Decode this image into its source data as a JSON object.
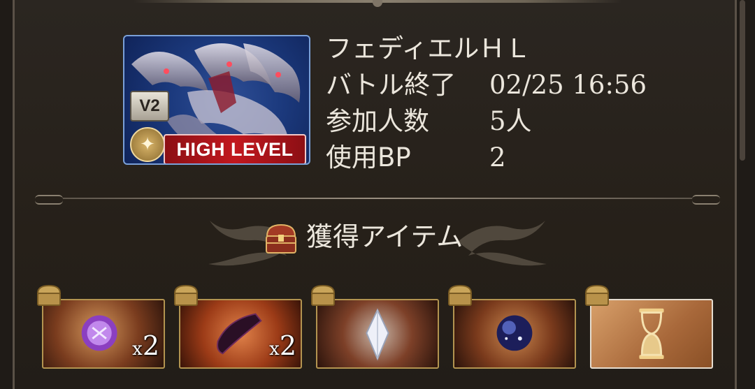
{
  "quest": {
    "name": "フェディエルＨＬ",
    "version_badge": "V2",
    "level_label": "HIGH LEVEL",
    "rows": [
      {
        "label": "バトル終了",
        "value": "02/25 16:56"
      },
      {
        "label": "参加人数",
        "value": "5人"
      },
      {
        "label": "使用BP",
        "value": "2"
      }
    ]
  },
  "loot": {
    "title": "獲得アイテム",
    "items": [
      {
        "icon": "purple-orb-icon",
        "qty_prefix": "x",
        "qty": "2"
      },
      {
        "icon": "dark-fang-icon",
        "qty_prefix": "x",
        "qty": "2"
      },
      {
        "icon": "silver-crystal-icon",
        "qty_prefix": "",
        "qty": ""
      },
      {
        "icon": "galaxy-orb-icon",
        "qty_prefix": "",
        "qty": ""
      },
      {
        "icon": "hourglass-icon",
        "qty_prefix": "",
        "qty": ""
      }
    ]
  },
  "colors": {
    "panel_bg": "#262019",
    "text": "#ebe6dc",
    "high_level_red": "#c2181f",
    "thumb_blue": "#1c3a7e",
    "gold_frame": "#b39450"
  }
}
